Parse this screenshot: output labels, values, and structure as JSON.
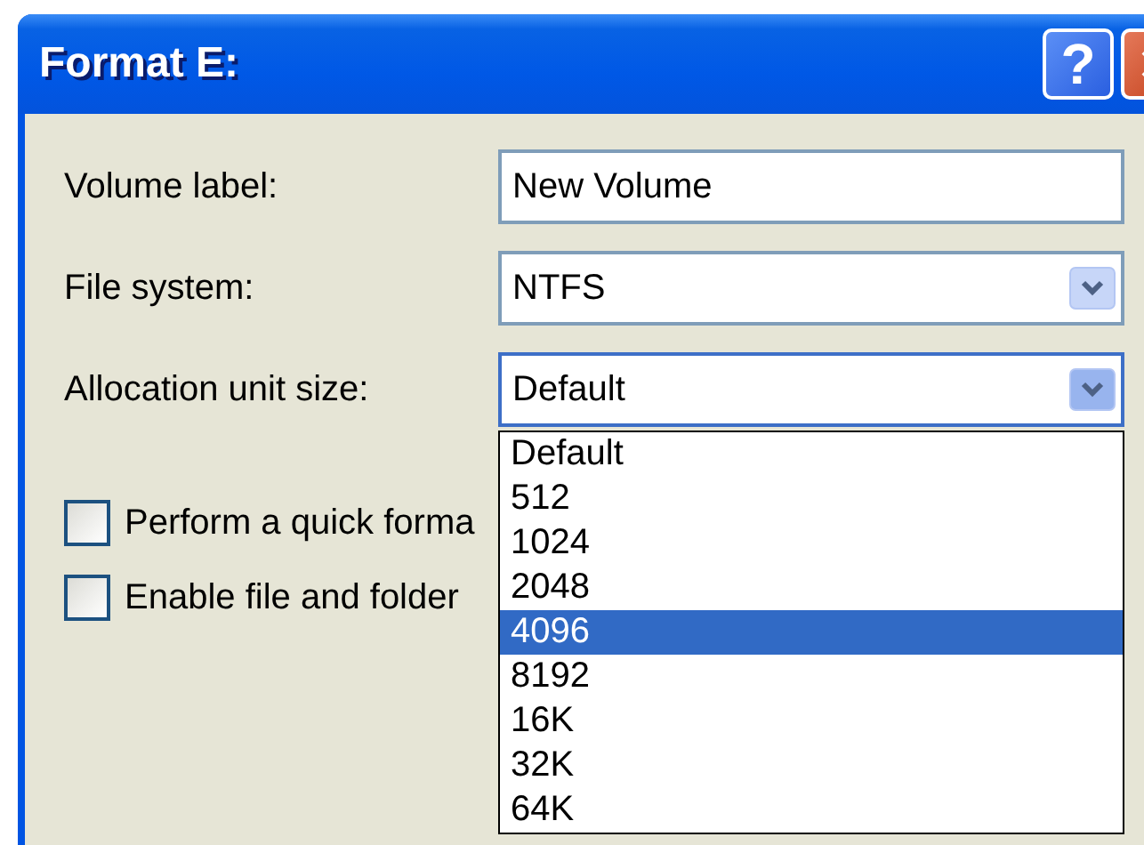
{
  "window": {
    "title": "Format E:",
    "buttons": [
      {
        "kind": "help",
        "label": "?"
      },
      {
        "kind": "close"
      }
    ]
  },
  "fields": [
    {
      "kind": "text",
      "label": "Volume label:",
      "value": "New Volume"
    },
    {
      "kind": "select",
      "label": "File system:",
      "value": "NTFS"
    },
    {
      "kind": "select",
      "label": "Allocation unit size:",
      "value": "Default",
      "expanded": true
    }
  ],
  "options": [
    {
      "label": "Perform a quick forma",
      "checked": false
    },
    {
      "label": "Enable file and folder",
      "checked": false
    }
  ],
  "dropdown": {
    "items": [
      {
        "label": "Default",
        "selected": false
      },
      {
        "label": "512",
        "selected": false
      },
      {
        "label": "1024",
        "selected": false
      },
      {
        "label": "2048",
        "selected": false
      },
      {
        "label": "4096",
        "selected": true
      },
      {
        "label": "8192",
        "selected": false
      },
      {
        "label": "16K",
        "selected": false
      },
      {
        "label": "32K",
        "selected": false
      },
      {
        "label": "64K",
        "selected": false
      }
    ]
  }
}
